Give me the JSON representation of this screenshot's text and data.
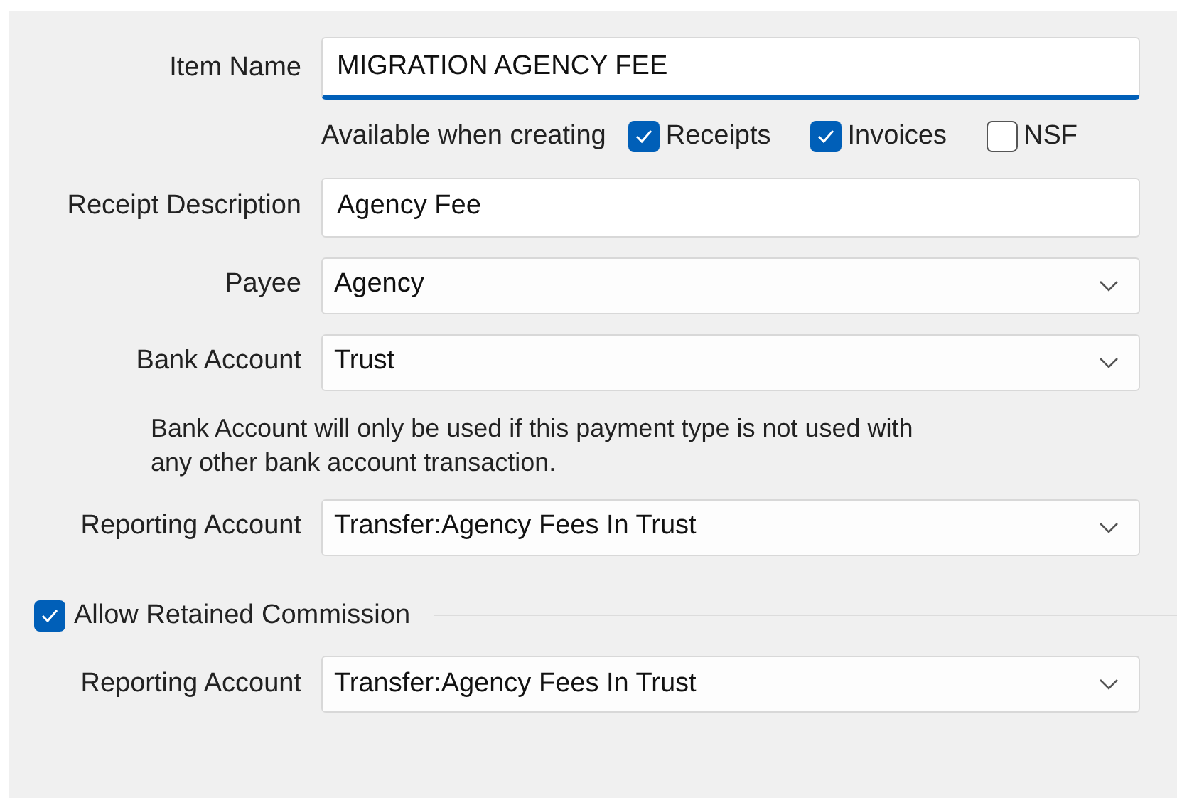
{
  "item_name": {
    "label": "Item Name",
    "value": "MIGRATION AGENCY FEE",
    "focused": true
  },
  "available_when_creating": {
    "label": "Available when creating",
    "options": [
      {
        "label": "Receipts",
        "checked": true
      },
      {
        "label": "Invoices",
        "checked": true
      },
      {
        "label": "NSF",
        "checked": false
      }
    ]
  },
  "fields": [
    {
      "kind": "text",
      "label": "Receipt Description",
      "value": "Agency Fee"
    },
    {
      "kind": "select",
      "label": "Payee",
      "value": "Agency"
    },
    {
      "kind": "select",
      "label": "Bank Account",
      "value": "Trust"
    },
    {
      "kind": "note",
      "text": "Bank Account will only be used if this payment type is not used with any other bank account transaction."
    },
    {
      "kind": "select",
      "label": "Reporting Account",
      "value": "Transfer:Agency Fees In Trust"
    }
  ],
  "retained_commission": {
    "label": "Allow Retained Commission",
    "checked": true,
    "fields": [
      {
        "kind": "select",
        "label": "Reporting Account",
        "value": "Transfer:Agency Fees In Trust"
      }
    ]
  }
}
